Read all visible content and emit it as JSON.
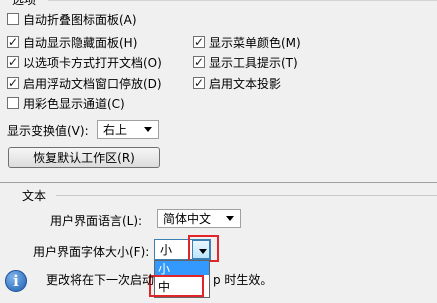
{
  "panel_options": {
    "clipped_top_text": "选项",
    "auto_collapse": {
      "label": "自动折叠图标面板(A)",
      "checked": false
    },
    "auto_show_hidden": {
      "label": "自动显示隐藏面板(H)",
      "checked": true
    },
    "open_as_tabs": {
      "label": "以选项卡方式打开文档(O)",
      "checked": true
    },
    "floating_dock": {
      "label": "启用浮动文档窗口停放(D)",
      "checked": true
    },
    "color_channels": {
      "label": "用彩色显示通道(C)",
      "checked": false
    },
    "menu_colors": {
      "label": "显示菜单颜色(M)",
      "checked": true
    },
    "tool_tips": {
      "label": "显示工具提示(T)",
      "checked": true
    },
    "text_shadow": {
      "label": "启用文本投影",
      "checked": true
    },
    "transform_values_label": "显示变换值(V):",
    "transform_values_selected": "右上",
    "reset_workspace_button": "恢复默认工作区(R)"
  },
  "text_section": {
    "heading": "文本",
    "ui_language_label": "用户界面语言(L):",
    "ui_language_selected": "简体中文",
    "ui_font_size_label": "用户界面字体大小(F):",
    "ui_font_size_selected": "小",
    "font_size_options": [
      "小",
      "中"
    ],
    "info_prefix": "更改将在下一次启动",
    "info_suffix": "p 时生效。"
  },
  "colors": {
    "highlight": "#3399ff",
    "annotation_red": "#e0262b"
  }
}
